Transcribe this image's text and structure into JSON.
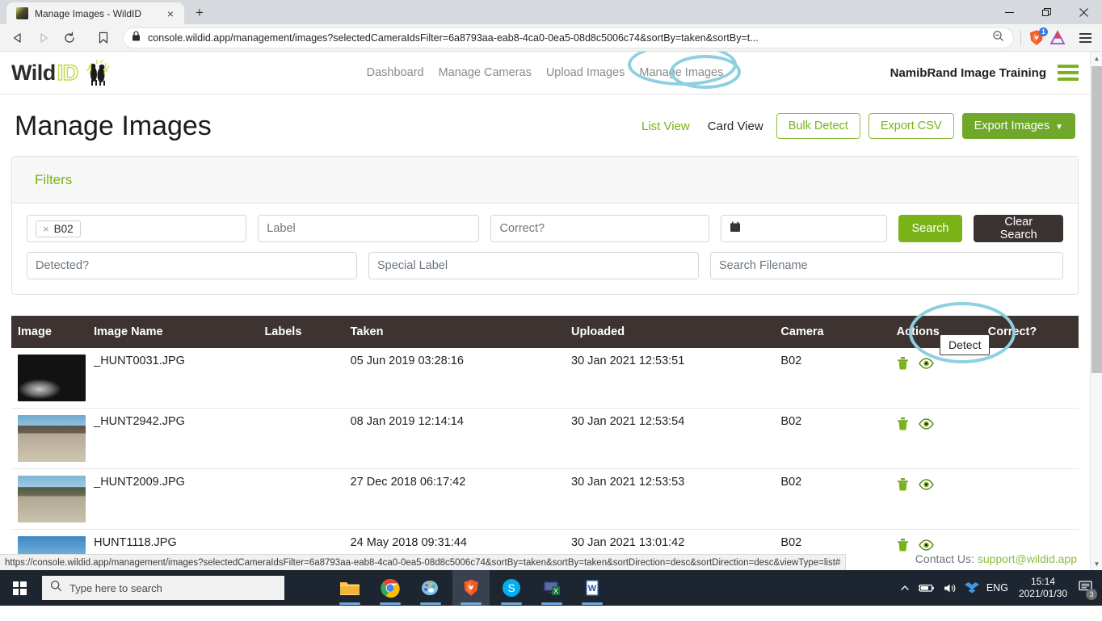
{
  "browser": {
    "tab_title": "Manage Images - WildID",
    "tab_close": "×",
    "new_tab": "+",
    "back_icon": "◁",
    "forward_icon": "▷",
    "reload_icon": "⟳",
    "bookmark_icon": "🔖",
    "url": "console.wildid.app/management/images?selectedCameraIdsFilter=6a8793aa-eab8-4ca0-0ea5-08d8c5006c74&sortBy=taken&sortBy=t...",
    "lock_icon": "🔒",
    "zoom_out_icon": "⊖",
    "shield_badge": "1",
    "minimize": "—",
    "maximize": "❐",
    "close": "✕"
  },
  "status_bar": {
    "link_preview": "https://console.wildid.app/management/images?selectedCameraIdsFilter=6a8793aa-eab8-4ca0-0ea5-08d8c5006c74&sortBy=taken&sortBy=taken&sortDirection=desc&sortDirection=desc&viewType=list#"
  },
  "app": {
    "logo_wild": "Wild",
    "logo_id": "ID",
    "nav": [
      {
        "label": "Dashboard",
        "active": false
      },
      {
        "label": "Manage Cameras",
        "active": false
      },
      {
        "label": "Upload Images",
        "active": false
      },
      {
        "label": "Manage Images",
        "active": true
      }
    ],
    "org_name": "NamibRand Image Training"
  },
  "page": {
    "title": "Manage Images",
    "view_list": "List View",
    "view_card": "Card View",
    "btn_bulk_detect": "Bulk Detect",
    "btn_export_csv": "Export CSV",
    "btn_export_images": "Export Images",
    "export_caret": "▼"
  },
  "filters": {
    "title": "Filters",
    "camera_tag": "B02",
    "camera_tag_remove": "×",
    "label_placeholder": "Label",
    "correct_placeholder": "Correct?",
    "date_icon": "📅",
    "btn_search": "Search",
    "btn_clear": "Clear Search",
    "detected_placeholder": "Detected?",
    "special_label_placeholder": "Special Label",
    "filename_placeholder": "Search Filename"
  },
  "table": {
    "columns": [
      "Image",
      "Image Name",
      "Labels",
      "Taken",
      "Uploaded",
      "Camera",
      "Actions",
      "Correct?"
    ],
    "rows": [
      {
        "thumb_class": "thumb-night",
        "name": "_HUNT0031.JPG",
        "labels": "",
        "taken": "05 Jun 2019 03:28:16",
        "uploaded": "30 Jan 2021 12:53:51",
        "camera": "B02",
        "correct": ""
      },
      {
        "thumb_class": "thumb-rocky",
        "name": "_HUNT2942.JPG",
        "labels": "",
        "taken": "08 Jan 2019 12:14:14",
        "uploaded": "30 Jan 2021 12:53:54",
        "camera": "B02",
        "correct": ""
      },
      {
        "thumb_class": "thumb-rocky2",
        "name": "_HUNT2009.JPG",
        "labels": "",
        "taken": "27 Dec 2018 06:17:42",
        "uploaded": "30 Jan 2021 12:53:53",
        "camera": "B02",
        "correct": ""
      },
      {
        "thumb_class": "thumb-sky",
        "name": "HUNT1118.JPG",
        "labels": "",
        "taken": "24 May 2018 09:31:44",
        "uploaded": "30 Jan 2021 13:01:42",
        "camera": "B02",
        "correct": ""
      }
    ]
  },
  "tooltip": {
    "detect": "Detect"
  },
  "footer": {
    "contact_label": "Contact Us:",
    "contact_email": "support@wildid.app"
  },
  "taskbar": {
    "search_placeholder": "Type here to search",
    "language": "ENG",
    "time": "15:14",
    "date": "2021/01/30",
    "notification_count": "3"
  },
  "colors": {
    "brand_green": "#7ab317",
    "solid_green": "#6fa82a",
    "dark_header": "#3d3431",
    "annotation_blue": "#8ecfe0",
    "taskbar": "#1d2531"
  }
}
